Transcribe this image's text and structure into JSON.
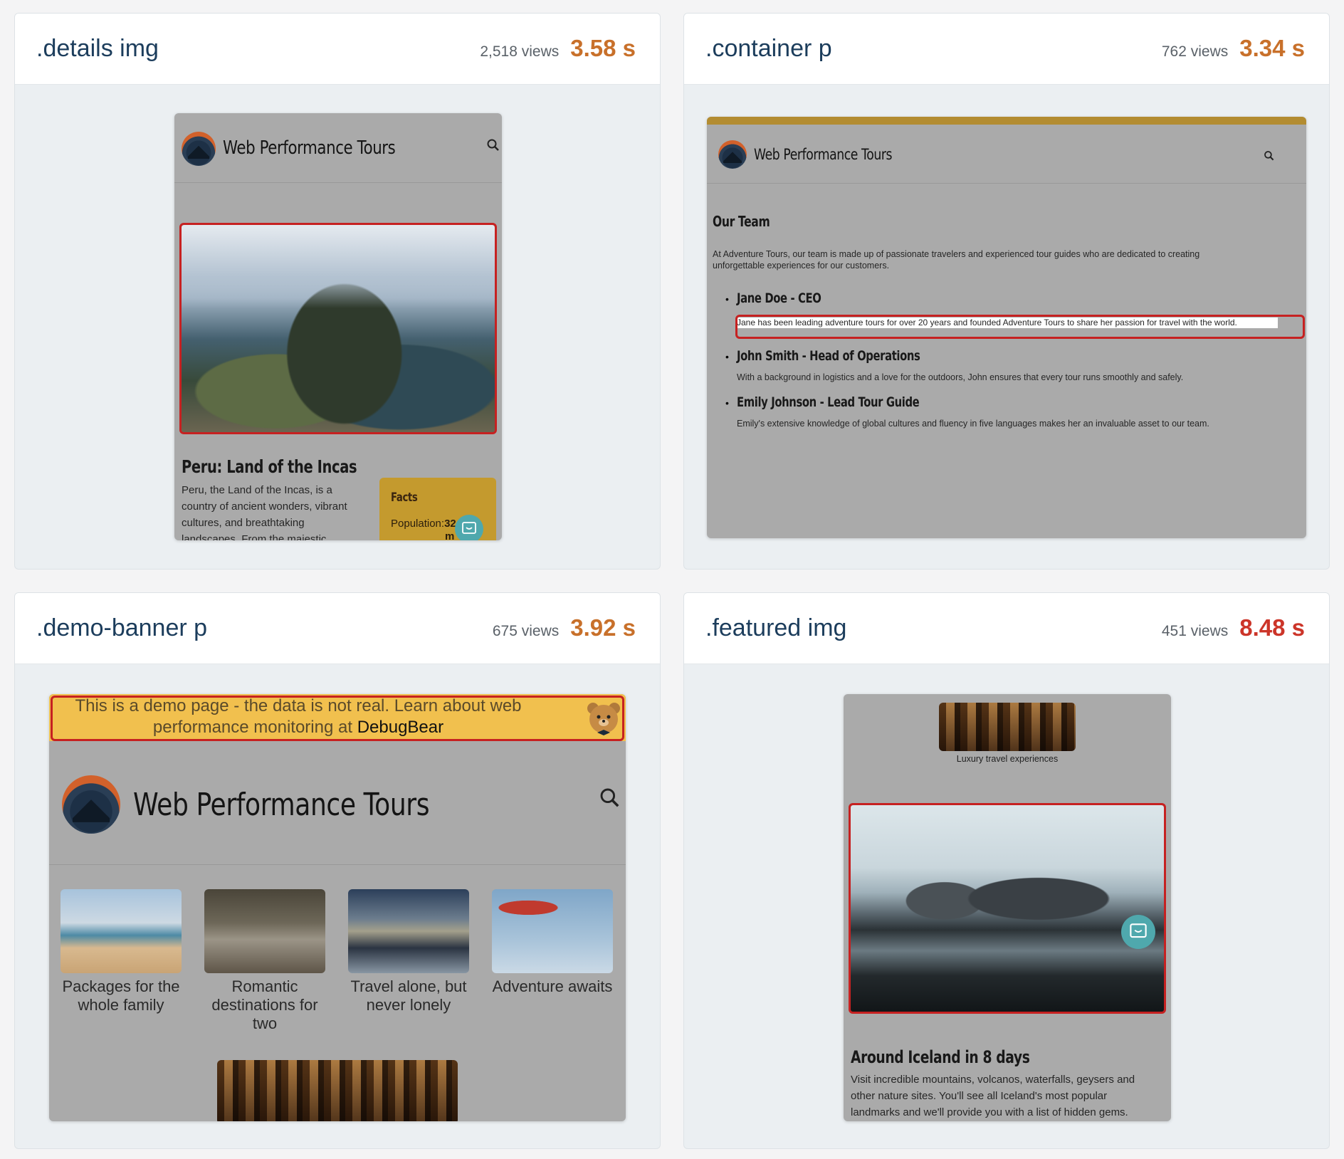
{
  "cards": [
    {
      "selector": ".details img",
      "views": "2,518 views",
      "timing": "3.58 s",
      "timing_color": "#c8702a"
    },
    {
      "selector": ".container p",
      "views": "762 views",
      "timing": "3.34 s",
      "timing_color": "#c8702a"
    },
    {
      "selector": ".demo-banner p",
      "views": "675 views",
      "timing": "3.92 s",
      "timing_color": "#c8702a"
    },
    {
      "selector": ".featured img",
      "views": "451 views",
      "timing": "8.48 s",
      "timing_color": "#cc3529"
    }
  ],
  "site": {
    "name": "Web Performance Tours"
  },
  "peru": {
    "heading": "Peru: Land of the Incas",
    "text": "Peru, the Land of the Incas, is a country of ancient wonders, vibrant cultures, and breathtaking landscapes. From the majestic",
    "facts_title": "Facts",
    "facts_line": "Population:",
    "facts_value": "32",
    "facts_unit": "m"
  },
  "team": {
    "heading": "Our Team",
    "intro": "At Adventure Tours, our team is made up of passionate travelers and experienced tour guides who are dedicated to creating unforgettable experiences for our customers.",
    "members": [
      {
        "name": "Jane Doe - CEO",
        "bio": "Jane has been leading adventure tours for over 20 years and founded Adventure Tours to share her passion for travel with the world."
      },
      {
        "name": "John Smith - Head of Operations",
        "bio": "With a background in logistics and a love for the outdoors, John ensures that every tour runs smoothly and safely."
      },
      {
        "name": "Emily Johnson - Lead Tour Guide",
        "bio": "Emily's extensive knowledge of global cultures and fluency in five languages makes her an invaluable asset to our team."
      }
    ]
  },
  "banner": {
    "text_prefix": "This is a demo page - the data is not real. Learn about web performance monitoring at ",
    "link": "DebugBear"
  },
  "tiles": [
    {
      "label": "Packages for the whole family"
    },
    {
      "label": "Romantic destinations for two"
    },
    {
      "label": "Travel alone, but never lonely"
    },
    {
      "label": "Adventure awaits"
    }
  ],
  "featured": {
    "caption": "Luxury travel experiences",
    "heading": "Around Iceland in 8 days",
    "text": "Visit incredible mountains, volcanos, waterfalls, geysers and other nature sites. You'll see all Iceland's most popular landmarks and we'll provide you with a list of hidden gems."
  }
}
